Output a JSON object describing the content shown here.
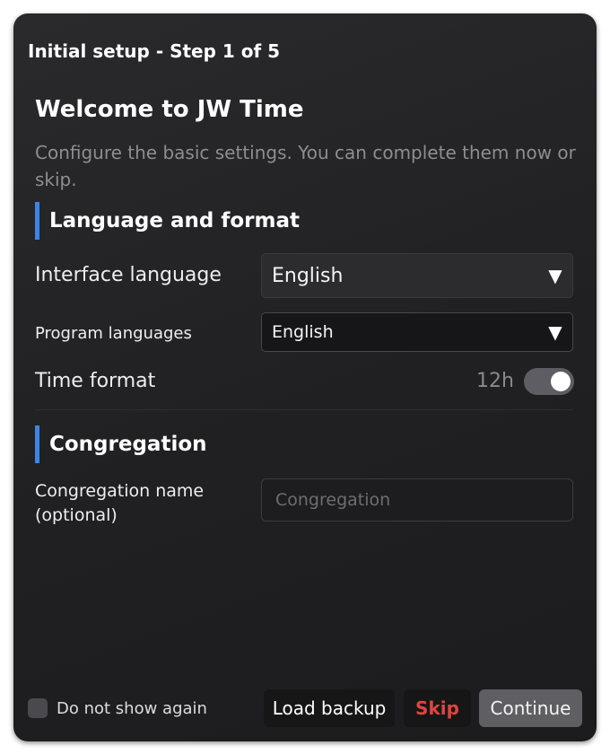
{
  "window": {
    "title": "Initial setup - Step 1 of 5"
  },
  "header": {
    "heading": "Welcome to JW Time",
    "subtitle": "Configure the basic settings. You can complete them now or skip."
  },
  "sections": {
    "language": {
      "title": "Language and format",
      "interface_language": {
        "label": "Interface language",
        "value": "English"
      },
      "program_languages": {
        "label": "Program languages",
        "value": "English"
      },
      "time_format": {
        "label": "Time format",
        "value": "12h",
        "enabled": true
      }
    },
    "congregation": {
      "title": "Congregation",
      "name_label": "Congregation name (optional)",
      "name_value": "",
      "name_placeholder": "Congregation"
    }
  },
  "footer": {
    "do_not_show_label": "Do not show again",
    "do_not_show_checked": false,
    "load_backup_label": "Load backup",
    "skip_label": "Skip",
    "continue_label": "Continue"
  },
  "icons": {
    "dropdown_arrow": "▼",
    "dropdown_icon_name": "triangle-down-icon"
  },
  "colors": {
    "accent": "#3c85e6",
    "danger": "#e0443f",
    "window_bg": "#222224"
  }
}
